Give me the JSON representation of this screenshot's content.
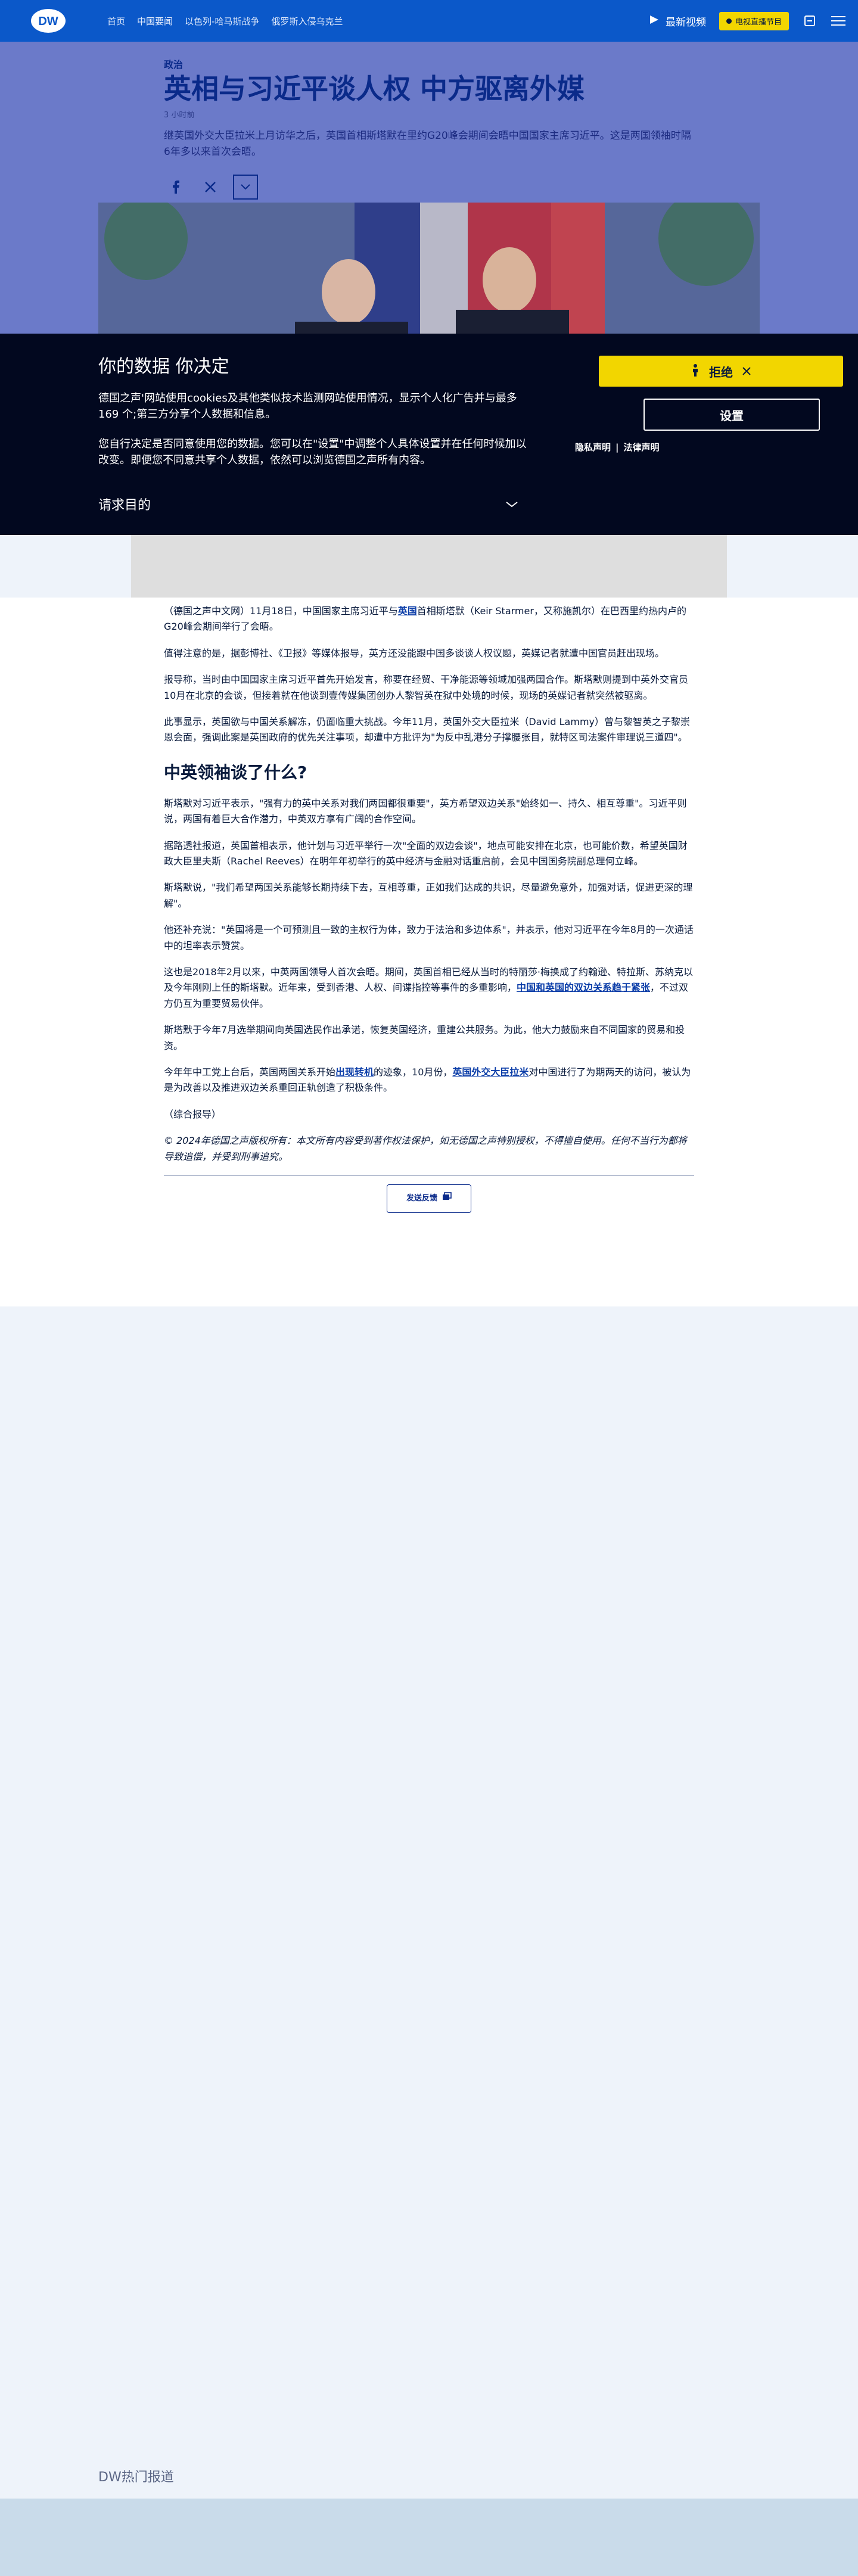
{
  "header": {
    "logo_text": "DW",
    "nav": [
      "首页",
      "中国要闻",
      "以色列-哈马斯战争",
      "俄罗斯入侵乌克兰"
    ],
    "latest_video_label": "最新视频",
    "live_label": "电视直播节目",
    "bg_color": "#0b58c9",
    "icons": [
      "play-icon",
      "language-icon",
      "menu-icon"
    ]
  },
  "article_header": {
    "category": "政治",
    "title": "英相与习近平谈人权 中方驱离外媒",
    "time_ago": "3 小时前",
    "lead": "继英国外交大臣拉米上月访华之后，英国首相斯塔默在里约G20峰会期间会晤中国国家主席习近平。这是两国领袖时隔6年多以来首次会晤。",
    "share_icons": [
      "facebook-icon",
      "x-icon",
      "chevron-down-icon"
    ]
  },
  "consent": {
    "title": "你的数据 你决定",
    "para1": "德国之声'网站使用cookies及其他类似技术监测网站使用情况，显示个人化广告并与最多169 个;第三方分享个人数据和信息。",
    "para2": "您自行决定是否同意使用您的数据。您可以在\"设置\"中调整个人具体设置并在任何时候加以改变。即便您不同意共享个人数据，依然可以浏览德国之声所有内容。",
    "purpose_label": "请求目的",
    "reject_label": "拒绝",
    "settings_label": "设置",
    "privacy_link": "隐私声明",
    "legal_link": "法律声明",
    "accent_color": "#f2d600"
  },
  "article": {
    "p1_a": "（德国之声中文网）11月18日，中国国家主席习近平与",
    "p1_link": "英国",
    "p1_b": "首相斯塔默（Keir Starmer，又称施凯尔）在巴西里约热内卢的G20峰会期间举行了会晤。",
    "p2": "值得注意的是，据彭博社、《卫报》等媒体报导，英方还没能跟中国多谈谈人权议题，英媒记者就遭中国官员赶出现场。",
    "p3": "报导称，当时由中国国家主席习近平首先开始发言，称要在经贸、干净能源等领域加强两国合作。斯塔默则提到中英外交官员10月在北京的会谈，但接着就在他谈到壹传媒集团创办人黎智英在狱中处境的时候，现场的英媒记者就突然被驱离。",
    "p4": "此事显示，英国欲与中国关系解冻，仍面临重大挑战。今年11月，英国外交大臣拉米（David Lammy）曾与黎智英之子黎崇恩会面，强调此案是英国政府的优先关注事项，却遭中方批评为\"为反中乱港分子撑腰张目，就特区司法案件审理说三道四\"。",
    "h_section": "中英领袖谈了什么?",
    "p5": "斯塔默对习近平表示，\"强有力的英中关系对我们两国都很重要\"，英方希望双边关系\"始终如一、持久、相互尊重\"。习近平则说，两国有着巨大合作潜力，中英双方享有广阔的合作空间。",
    "p6": "据路透社报道，英国首相表示，他计划与习近平举行一次\"全面的双边会谈\"，地点可能安排在北京，也可能价数，希望英国财政大臣里夫斯（Rachel Reeves）在明年年初举行的英中经济与金融对话重启前，会见中国国务院副总理何立峰。",
    "p7": "斯塔默说，\"我们希望两国关系能够长期持续下去，互相尊重，正如我们达成的共识，尽量避免意外，加强对话，促进更深的理解\"。",
    "p8": "他还补充说：\"英国将是一个可预测且一致的主权行为体，致力于法治和多边体系\"，并表示，他对习近平在今年8月的一次通话中的坦率表示赞赏。",
    "p9_a": "这也是2018年2月以来，中英两国领导人首次会晤。期间，英国首相已经从当时的特丽莎·梅换成了约翰逊、特拉斯、苏纳克以及今年刚刚上任的斯塔默。近年来，受到香港、人权、间谍指控等事件的多重影响，",
    "p9_link": "中国和英国的双边关系趋于紧张",
    "p9_b": "，不过双方仍互为重要贸易伙伴。",
    "p10": "斯塔默于今年7月选举期间向英国选民作出承诺，恢复英国经济，重建公共服务。为此，他大力鼓励来自不同国家的贸易和投资。",
    "p11_a": "今年年中工党上台后，英国两国关系开始",
    "p11_link1": "出现转机",
    "p11_b": "的迹象，10月份，",
    "p11_link2": "英国外交大臣拉米",
    "p11_c": "对中国进行了为期两天的访问，被认为是为改善以及推进双边关系重回正轨创造了积极条件。",
    "source": "（综合报导）",
    "copyright": "© 2024年德国之声版权所有：本文所有内容受到著作权法保护，如无德国之声特别授权，不得擅自使用。任何不当行为都将导致追偿，并受到刑事追究。",
    "feedback_label": "发送反馈"
  },
  "bottom": {
    "section_title": "DW热门报道"
  }
}
